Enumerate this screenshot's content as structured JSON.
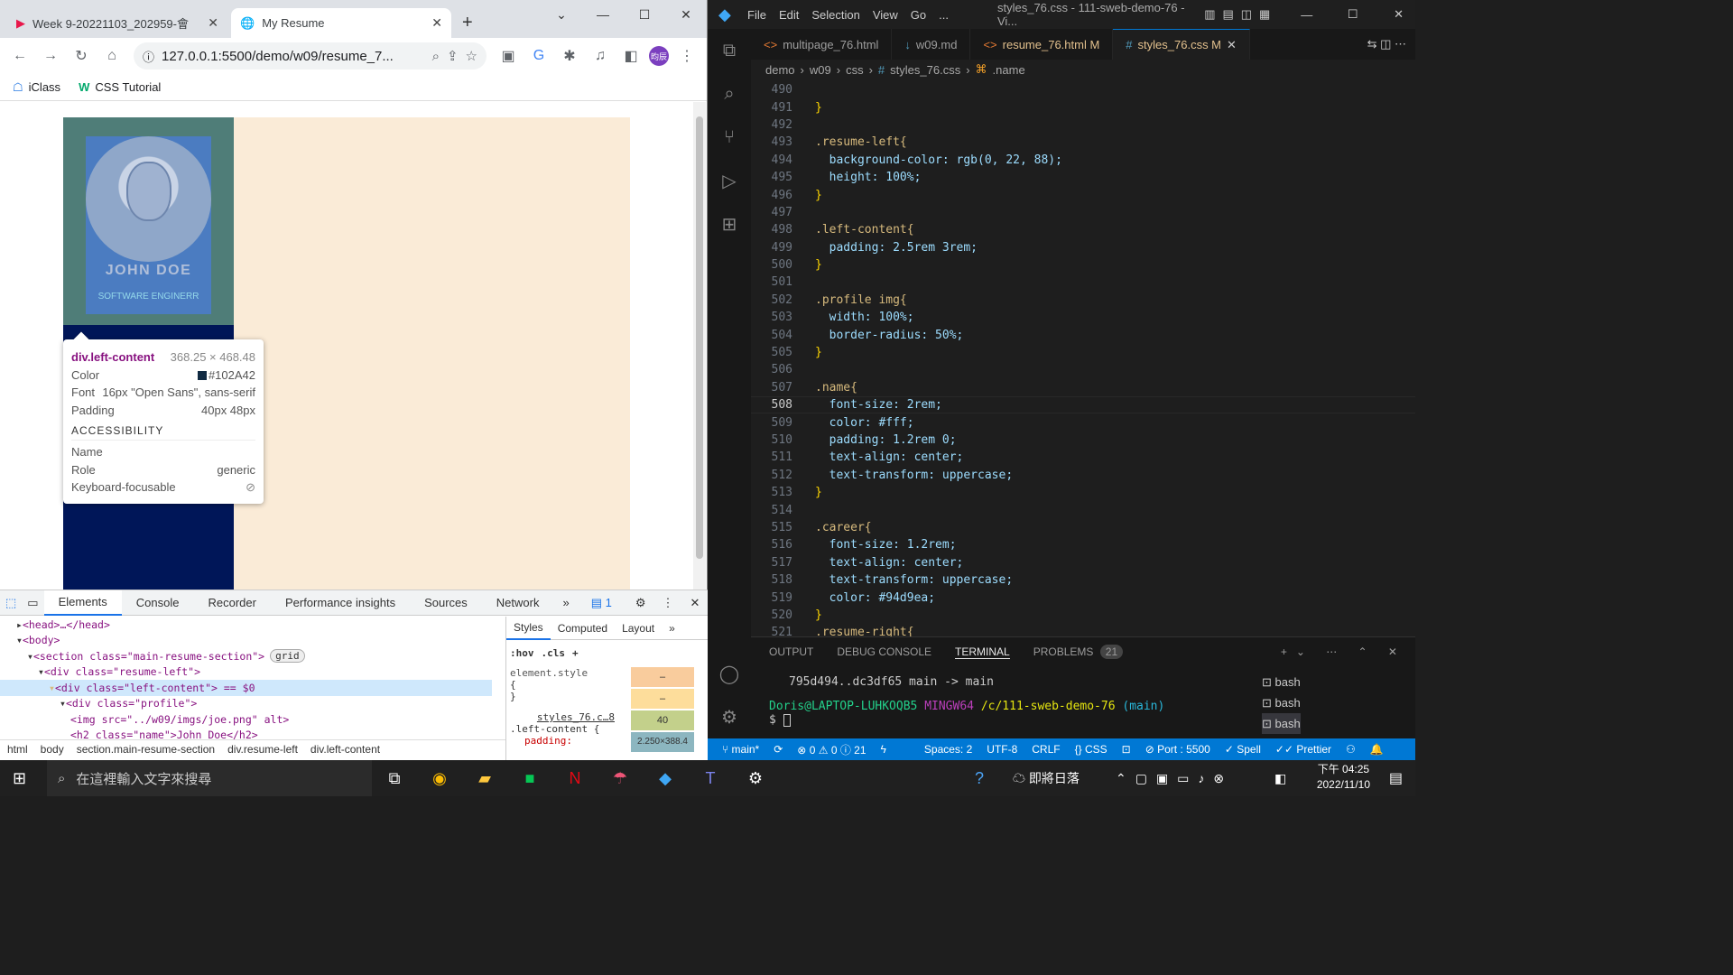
{
  "browser": {
    "tabs": [
      {
        "label": "Week 9-20221103_202959-會"
      },
      {
        "label": "My Resume"
      }
    ],
    "url": "127.0.0.1:5500/demo/w09/resume_7...",
    "profile_initials": "昀辰",
    "bookmarks": [
      "iClass",
      "CSS Tutorial"
    ]
  },
  "resume": {
    "name": "JOHN DOE",
    "career": "SOFTWARE ENGINERR"
  },
  "tooltip": {
    "selector": "div.left-content",
    "size": "368.25 × 468.48",
    "color_label": "Color",
    "color_value": "#102A42",
    "font_label": "Font",
    "font_value": "16px \"Open Sans\", sans-serif",
    "padding_label": "Padding",
    "padding_value": "40px 48px",
    "accessibility": "ACCESSIBILITY",
    "name_label": "Name",
    "role_label": "Role",
    "role_value": "generic",
    "keyboard_label": "Keyboard-focusable"
  },
  "devtools": {
    "tabs": [
      "Elements",
      "Console",
      "Recorder",
      "Performance insights",
      "Sources",
      "Network"
    ],
    "issues": "1",
    "dom_lines": [
      {
        "indent": 1,
        "text": "<head>…</head>"
      },
      {
        "indent": 1,
        "text": "<body>"
      },
      {
        "indent": 2,
        "text": "<section class=\"main-resume-section\">",
        "badge": "grid"
      },
      {
        "indent": 3,
        "text": "<div class=\"resume-left\">"
      },
      {
        "indent": 4,
        "text": "<div class=\"left-content\"> == $0"
      },
      {
        "indent": 5,
        "text": "<div class=\"profile\">"
      },
      {
        "indent": 6,
        "text": "<img src=\"../w09/imgs/joe.png\" alt>"
      },
      {
        "indent": 6,
        "text": "<h2 class=\"name\">John Doe</h2>"
      }
    ],
    "breadcrumbs": [
      "html",
      "body",
      "section.main-resume-section",
      "div.resume-left",
      "div.left-content"
    ],
    "styles_tabs": [
      "Styles",
      "Computed",
      "Layout"
    ],
    "filter_hov": ":hov",
    "filter_cls": ".cls",
    "element_style": "element.style",
    "rule_source": "styles_76.c…8",
    "rule_selector": ".left-content {",
    "rule_prop": "padding:",
    "box_values": [
      "–",
      "–",
      "40",
      "2.250×388.4"
    ]
  },
  "vscode": {
    "menu": [
      "File",
      "Edit",
      "Selection",
      "View",
      "Go",
      "..."
    ],
    "title": "styles_76.css - 111-sweb-demo-76 - Vi...",
    "tabs": [
      {
        "label": "multipage_76.html"
      },
      {
        "label": "w09.md"
      },
      {
        "label": "resume_76.html M"
      },
      {
        "label": "styles_76.css M"
      }
    ],
    "breadcrumb": [
      "demo",
      "w09",
      "css",
      "styles_76.css",
      ".name"
    ],
    "lines": [
      {
        "n": "490",
        "t": ""
      },
      {
        "n": "491",
        "t": "}"
      },
      {
        "n": "492",
        "t": ""
      },
      {
        "n": "493",
        "t": ".resume-left{"
      },
      {
        "n": "494",
        "t": "  background-color: rgb(0, 22, 88);"
      },
      {
        "n": "495",
        "t": "  height: 100%;"
      },
      {
        "n": "496",
        "t": "}"
      },
      {
        "n": "497",
        "t": ""
      },
      {
        "n": "498",
        "t": ".left-content{"
      },
      {
        "n": "499",
        "t": "  padding: 2.5rem 3rem;"
      },
      {
        "n": "500",
        "t": "}"
      },
      {
        "n": "501",
        "t": ""
      },
      {
        "n": "502",
        "t": ".profile img{"
      },
      {
        "n": "503",
        "t": "  width: 100%;"
      },
      {
        "n": "504",
        "t": "  border-radius: 50%;"
      },
      {
        "n": "505",
        "t": "}"
      },
      {
        "n": "506",
        "t": ""
      },
      {
        "n": "507",
        "t": ".name{"
      },
      {
        "n": "508",
        "t": "  font-size: 2rem;"
      },
      {
        "n": "509",
        "t": "  color: #fff;"
      },
      {
        "n": "510",
        "t": "  padding: 1.2rem 0;"
      },
      {
        "n": "511",
        "t": "  text-align: center;"
      },
      {
        "n": "512",
        "t": "  text-transform: uppercase;"
      },
      {
        "n": "513",
        "t": "}"
      },
      {
        "n": "514",
        "t": ""
      },
      {
        "n": "515",
        "t": ".career{"
      },
      {
        "n": "516",
        "t": "  font-size: 1.2rem;"
      },
      {
        "n": "517",
        "t": "  text-align: center;"
      },
      {
        "n": "518",
        "t": "  text-transform: uppercase;"
      },
      {
        "n": "519",
        "t": "  color: #94d9ea;"
      },
      {
        "n": "520",
        "t": "}"
      },
      {
        "n": "521",
        "t": ".resume-right{"
      }
    ],
    "panel_tabs": [
      "OUTPUT",
      "DEBUG CONSOLE",
      "TERMINAL",
      "PROBLEMS"
    ],
    "problems_count": "21",
    "terminal_line1": "795d494..dc3df65  main -> main",
    "terminal_user": "Doris@LAPTOP-LUHKOQB5",
    "terminal_env": "MINGW64",
    "terminal_path": "/c/111-sweb-demo-76",
    "terminal_branch": "(main)",
    "terminal_prompt": "$",
    "shells": [
      "bash",
      "bash",
      "bash"
    ],
    "status": {
      "branch": "main*",
      "errors": "0",
      "warnings": "0",
      "infos": "21",
      "spaces": "Spaces: 2",
      "encoding": "UTF-8",
      "eol": "CRLF",
      "lang": "CSS",
      "port": "Port : 5500",
      "spell": "Spell",
      "prettier": "Prettier"
    }
  },
  "taskbar": {
    "search_placeholder": "在這裡輸入文字來搜尋",
    "weather": "即將日落",
    "time": "下午 04:25",
    "date": "2022/11/10"
  }
}
